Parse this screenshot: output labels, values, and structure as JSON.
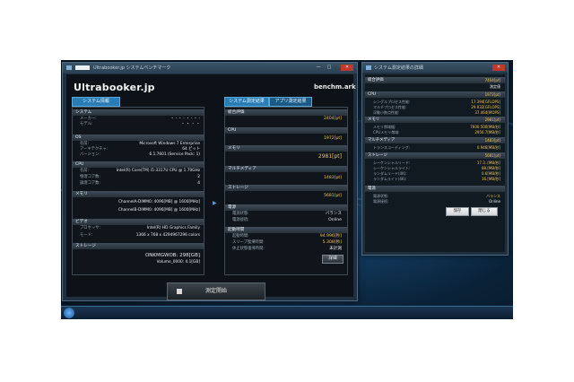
{
  "desktop": {
    "tray": "",
    "start_label": ""
  },
  "main_window": {
    "title": "Ultrabooker.jp システムベンチマーク",
    "min": "—",
    "max": "□",
    "close": "✕",
    "logo": "Ultrabooker.jp",
    "logo_right": "benchm.ark",
    "tab_left": "システム情報",
    "tab_result": "システム測定結果",
    "tab_app": "アプリ測定結果",
    "start_button": "測定開始",
    "detail_button": "詳細"
  },
  "system_info": {
    "system": {
      "header": "システム",
      "rows": [
        {
          "k": "メーカー:",
          "v": "・ - ・ - ・ - ・ -"
        },
        {
          "k": "モデル:",
          "v": "・ ・ ・ ・"
        }
      ]
    },
    "os": {
      "header": "OS",
      "rows": [
        {
          "k": "名前:",
          "v": "Microsoft Windows 7 Enterprise"
        },
        {
          "k": "アーキテクチャ:",
          "v": "64 ビット"
        },
        {
          "k": "バージョン:",
          "v": "6.1.7601 (Service Pack: 1)"
        }
      ]
    },
    "cpu": {
      "header": "CPU",
      "rows": [
        {
          "k": "名前:",
          "v": "Intel(R) Core(TM) i5-3317U CPU @ 1.70GHz"
        },
        {
          "k": "物理コア数:",
          "v": "2"
        },
        {
          "k": "論理コア数:",
          "v": "4"
        }
      ]
    },
    "memory": {
      "header": "メモリ",
      "rows": [
        {
          "k": "",
          "v": "ChannelA-DIMM0: 4096[MB] @ 1600[MHz]"
        },
        {
          "k": "",
          "v": "ChannelB-DIMM0: 4096[MB] @ 1600[MHz]"
        }
      ]
    },
    "video": {
      "header": "ビデオ",
      "rows": [
        {
          "k": "プロセッサ:",
          "v": "Intel(R) HD Graphics Family"
        },
        {
          "k": "モード:",
          "v": "1366 x 768 x 4294967296 colors"
        }
      ]
    },
    "storage": {
      "header": "ストレージ",
      "rows": [
        {
          "k": "",
          "v": "ONKMGWOB: 298[GB]"
        },
        {
          "k": "",
          "v": "Volume_0000: 4.1[GB]"
        }
      ]
    }
  },
  "results": {
    "total": {
      "header": "総合評価",
      "value": "2404[pt]"
    },
    "cpu": {
      "header": "CPU",
      "value": "1972[pt]"
    },
    "memory": {
      "header": "メモリ",
      "value": "2981[pt]"
    },
    "multimedia": {
      "header": "マルチメディア",
      "value": "1483[pt]"
    },
    "storage": {
      "header": "ストレージ",
      "value": "5681[pt]"
    },
    "power": {
      "header": "電源",
      "rows": [
        {
          "k": "電源状態:",
          "v": "バランス"
        },
        {
          "k": "電源接続:",
          "v": "Online"
        }
      ]
    },
    "startup": {
      "header": "起動時間",
      "rows": [
        {
          "k": "起動時間:",
          "v": "94.996[秒]"
        },
        {
          "k": "スリープ復帰時間:",
          "v": "5.308[秒]"
        },
        {
          "k": "休止状態復帰時間:",
          "v": "未計測"
        }
      ]
    }
  },
  "detail_window": {
    "title": "システム測定結果の詳細",
    "close": "✕",
    "total": {
      "header": "総合評価",
      "value": "7404[pt]",
      "sub": "測定値"
    },
    "cpu": {
      "header": "CPU",
      "value": "1972[pt]",
      "rows": [
        {
          "k": "シングルプロセス性能:",
          "v": "17.394[GFLOPS]"
        },
        {
          "k": "マルチプロセス性能:",
          "v": "29.932[GFLOPS]"
        },
        {
          "k": "浮動小数点性能:",
          "v": "37.464[MOPS]"
        }
      ]
    },
    "memory": {
      "header": "メモリ",
      "value": "2981[pt]",
      "rows": [
        {
          "k": "メモリ帯域幅:",
          "v": "7600.500[MB/秒]"
        },
        {
          "k": "CPUメモリ帯域:",
          "v": "2956.7[MB/秒]"
        }
      ]
    },
    "multimedia": {
      "header": "マルチメディア",
      "value": "1483[pt]",
      "rows": [
        {
          "k": "トランスコーディング:",
          "v": "0.946[MB/秒]"
        }
      ]
    },
    "storage": {
      "header": "ストレージ",
      "value": "5681[pt]",
      "rows": [
        {
          "k": "シーケンシャルリード:",
          "v": "17.3..[MB/秒]"
        },
        {
          "k": "シーケンシャルライト:",
          "v": "88.[MB/秒]"
        },
        {
          "k": "ランダムリード(4K):",
          "v": "0.6[MB/秒]"
        },
        {
          "k": "ランダムライト(4K):",
          "v": "16.[MB/秒]"
        }
      ]
    },
    "power": {
      "header": "電源",
      "rows": [
        {
          "k": "電源状態:",
          "v": "バランス"
        },
        {
          "k": "電源接続:",
          "v": "Online"
        }
      ]
    },
    "btn_save": "保存",
    "btn_close": "閉じる"
  },
  "colors": {
    "accent": "#2a7db4",
    "score": "#f5c542",
    "desktop": "#0a2238"
  }
}
